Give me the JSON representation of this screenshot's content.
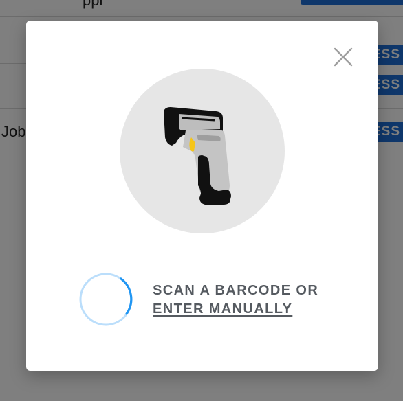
{
  "background": {
    "row_text": "Job",
    "top_text": "ppl",
    "row_button_label": "ESS"
  },
  "modal": {
    "prompt_line": "SCAN A BARCODE OR",
    "manual_link": "ENTER MANUALLY",
    "close_icon": "close-icon",
    "illustration_icon": "barcode-scanner-icon",
    "spinner_icon": "loading-spinner-icon"
  },
  "colors": {
    "overlay": "#000000",
    "accent": "#1f6fd6",
    "spinner": "#2196f3",
    "text": "#555a60"
  }
}
